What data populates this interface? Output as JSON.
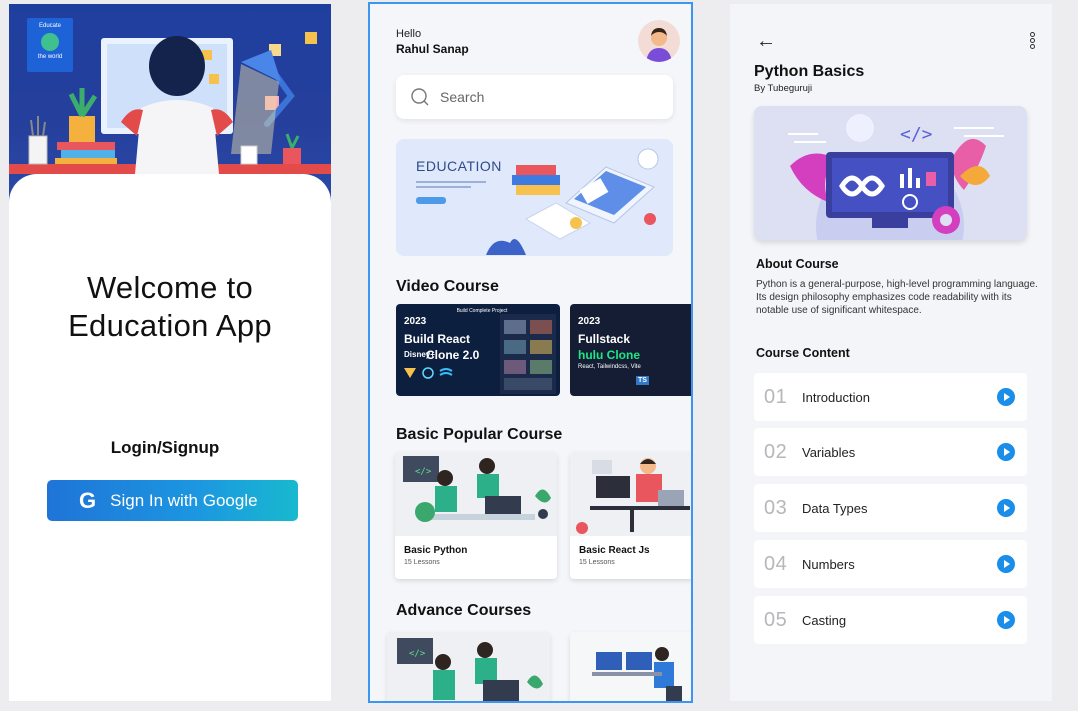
{
  "login_screen": {
    "welcome_line1": "Welcome to",
    "welcome_line2": "Education App",
    "login_label": "Login/Signup",
    "google_button_label": "Sign In with Google",
    "google_icon": "G",
    "book_title": "Educate",
    "book_subtitle": "the world"
  },
  "home_screen": {
    "greeting": "Hello",
    "user_name": "Rahul Sanap",
    "search_placeholder": "Search",
    "banner_title": "EDUCATION",
    "video_section_title": "Video Course",
    "video_courses": [
      {
        "year": "2023",
        "line1": "Build React",
        "line2": "Clone 2.0",
        "brand": "Disney+",
        "corner_label": "Build Complete Project"
      },
      {
        "year": "2023",
        "line1": "Fullstack",
        "line2": "hulu Clone",
        "sub": "React, Tailwindcss, Vite",
        "badge": "TS"
      }
    ],
    "popular_section_title": "Basic Popular Course",
    "popular_courses": [
      {
        "title": "Basic Python",
        "lessons": "15 Lessons"
      },
      {
        "title": "Basic React Js",
        "lessons": "15 Lessons"
      }
    ],
    "advance_section_title": "Advance  Courses"
  },
  "course_screen": {
    "back_icon": "arrow-left-icon",
    "menu_icon": "more-vertical-icon",
    "title": "Python Basics",
    "byline": "By Tubeguruji",
    "about_heading": "About Course",
    "about_text": "Python is a general-purpose, high-level programming language. Its design philosophy emphasizes code readability with its notable use of significant whitespace.",
    "content_heading": "Course Content",
    "lessons": [
      {
        "number": "01",
        "title": "Introduction"
      },
      {
        "number": "02",
        "title": "Variables"
      },
      {
        "number": "03",
        "title": "Data Types"
      },
      {
        "number": "04",
        "title": "Numbers"
      },
      {
        "number": "05",
        "title": "Casting"
      }
    ],
    "accent_color": "#1a8ee8"
  }
}
